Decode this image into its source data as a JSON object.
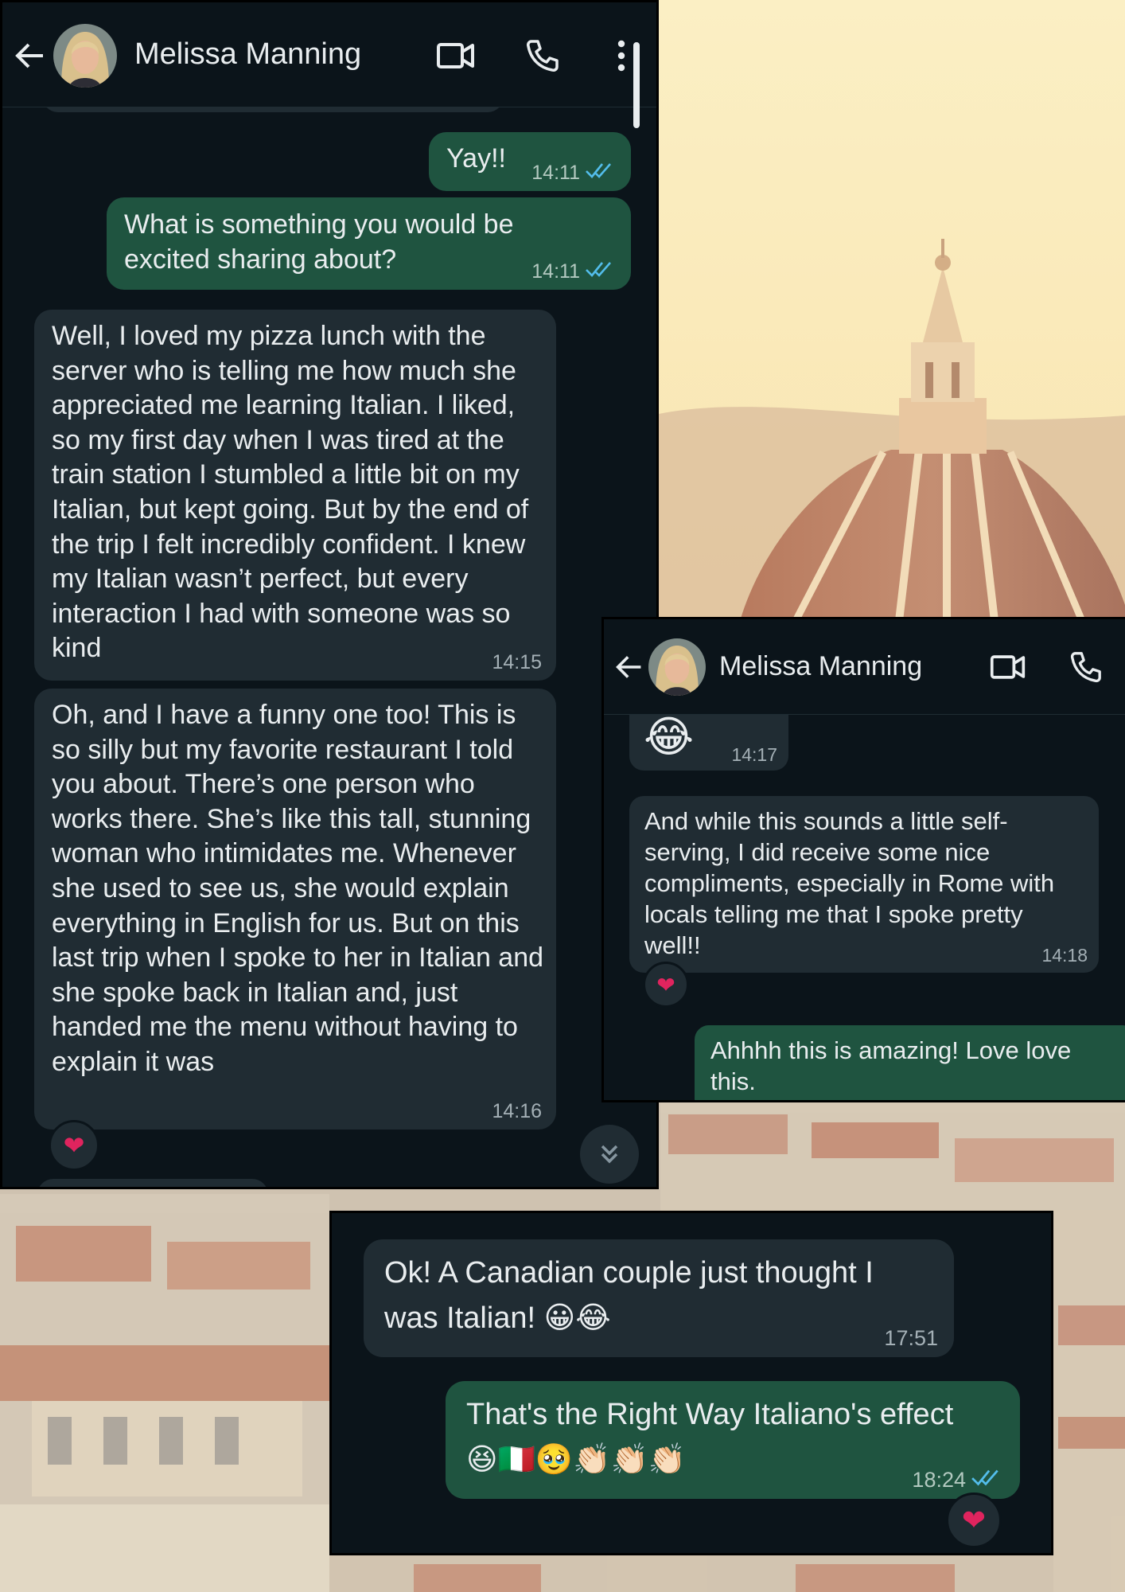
{
  "contact": {
    "name": "Melissa Manning"
  },
  "icons": {
    "back": "back-arrow-icon",
    "video": "video-call-icon",
    "call": "phone-call-icon",
    "menu": "more-options-icon",
    "scroll_down": "scroll-down-icon",
    "heart": "heart-reaction-icon"
  },
  "colors": {
    "chat_bg": "#0b141a",
    "incoming_bubble": "#202c33",
    "outgoing_bubble": "#1f5440",
    "read_ticks": "#53bdeb",
    "heart": "#e0245e"
  },
  "window1": {
    "messages": [
      {
        "dir": "out",
        "text": "Yay!!",
        "time": "14:11",
        "read": true
      },
      {
        "dir": "out",
        "text": "What is something you would be excited sharing about?",
        "time": "14:11",
        "read": true
      },
      {
        "dir": "in",
        "text": "Well, I loved my pizza lunch with the server who is telling me how much she appreciated me learning Italian. I liked, so my first day when I was tired at the train station I stumbled a little bit on my Italian, but kept going. But by the end of the trip I felt incredibly confident. I knew my Italian wasn’t perfect, but every interaction I had with someone was so kind",
        "time": "14:15"
      },
      {
        "dir": "in",
        "text": "Oh, and I have a funny one too! This is so silly but my favorite restaurant I told you about. There’s one person who works there. She’s like this tall, stunning woman who intimidates me. Whenever she used to see us, she would explain everything in English for us. But on this last trip when I spoke to her in Italian and she spoke back in Italian and, just handed me the menu without having to explain it was",
        "time": "14:16",
        "reaction": "❤"
      }
    ]
  },
  "window2": {
    "messages": [
      {
        "dir": "in",
        "text": "😂",
        "time": "14:17"
      },
      {
        "dir": "in",
        "text": "And while this sounds a little self-serving, I did receive some nice compliments, especially in Rome with locals telling me that I spoke pretty well!!",
        "time": "14:18",
        "reaction": "❤"
      },
      {
        "dir": "out",
        "text": "Ahhhh this is amazing! Love love this."
      }
    ]
  },
  "window3": {
    "messages": [
      {
        "dir": "in",
        "text": "Ok! A Canadian couple just thought I was Italian! 😀😂",
        "time": "17:51"
      },
      {
        "dir": "out",
        "text": "That's the Right Way Italiano's effect 😆🇮🇹🥹👏🏻👏🏻👏🏻",
        "time": "18:24",
        "read": true,
        "reaction": "❤"
      }
    ]
  }
}
